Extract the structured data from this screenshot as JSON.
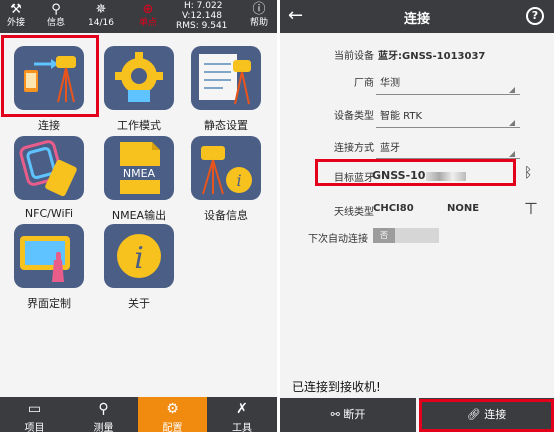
{
  "left": {
    "status": {
      "external": "外接",
      "info": "信息",
      "satellites": "14/16",
      "mode": "单点",
      "h": "H: 7.022",
      "v": "V:12.148",
      "rms": "RMS: 9.541",
      "help": "帮助"
    },
    "apps": [
      {
        "label": "连接"
      },
      {
        "label": "工作模式"
      },
      {
        "label": "静态设置"
      },
      {
        "label": "NFC/WiFi"
      },
      {
        "label": "NMEA输出"
      },
      {
        "label": "设备信息"
      },
      {
        "label": "界面定制"
      },
      {
        "label": "关于"
      }
    ],
    "nav": [
      {
        "label": "项目"
      },
      {
        "label": "测量"
      },
      {
        "label": "配置"
      },
      {
        "label": "工具"
      }
    ],
    "nmea_text": "NMEA"
  },
  "right": {
    "title": "连接",
    "current_device_label": "当前设备",
    "current_device_value": "蓝牙:GNSS-1013037",
    "manufacturer_label": "厂商",
    "manufacturer_value": "华测",
    "device_type_label": "设备类型",
    "device_type_value": "智能 RTK",
    "connect_method_label": "连接方式",
    "connect_method_value": "蓝牙",
    "target_bt_label": "目标蓝牙",
    "target_bt_value": "GNSS-10",
    "antenna_label": "天线类型",
    "antenna_value": "CHCI80",
    "antenna_value2": "NONE",
    "auto_connect_label": "下次自动连接",
    "auto_connect_state": "否",
    "message": "已连接到接收机!",
    "disconnect_label": "断开",
    "connect_label": "连接"
  },
  "colors": {
    "accent": "#f08b10",
    "highlight": "#e3001b",
    "bar": "#3a3c40",
    "tile": "#4b5e86"
  }
}
